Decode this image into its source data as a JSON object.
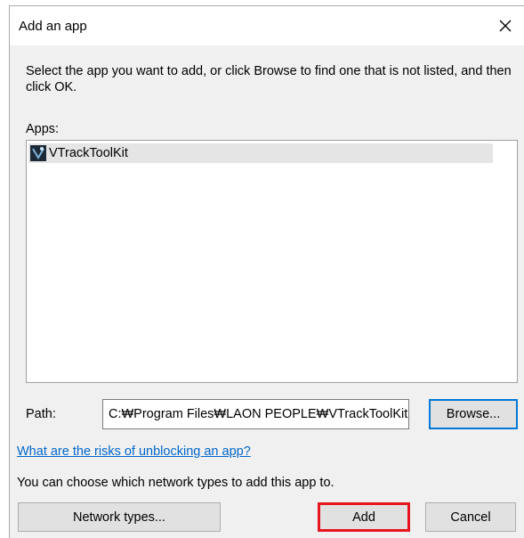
{
  "dialog": {
    "title": "Add an app",
    "close_symbol": "✕",
    "instructions": "Select the app you want to add, or click Browse to find one that is not listed, and then click OK.",
    "apps_label": "Apps:",
    "apps": [
      {
        "name": "VTrackToolKit",
        "icon": "vtrack-app-icon",
        "selected": true
      }
    ],
    "path_label": "Path:",
    "path_value": "C:₩Program Files₩LAON PEOPLE₩VTrackToolKit",
    "browse_label": "Browse...",
    "risks_link": "What are the risks of unblocking an app?",
    "network_note": "You can choose which network types to add this app to.",
    "network_types_label": "Network types...",
    "add_label": "Add",
    "cancel_label": "Cancel"
  },
  "colors": {
    "link": "#0066cc",
    "highlight_border": "#e8141e",
    "focus_border": "#0078d7",
    "selection": "#e5e5e5"
  }
}
